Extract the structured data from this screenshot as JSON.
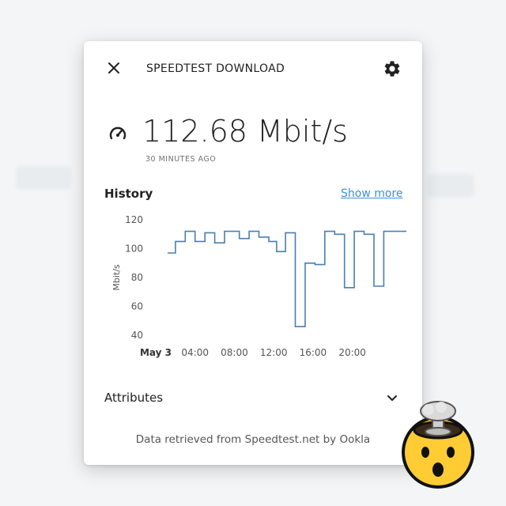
{
  "header": {
    "title": "SPEEDTEST DOWNLOAD"
  },
  "reading": {
    "value": "112.68",
    "unit": "Mbit/s",
    "time_ago": "30 MINUTES AGO"
  },
  "history": {
    "label": "History",
    "show_more": "Show more"
  },
  "chart_data": {
    "type": "line",
    "step": true,
    "ylabel": "Mbit/s",
    "ylim": [
      40,
      120
    ],
    "yticks": [
      40,
      60,
      80,
      100,
      120
    ],
    "xlim": [
      0,
      25.5
    ],
    "xticks": [
      {
        "hour": 0,
        "label": "May 3",
        "bold": true
      },
      {
        "hour": 4,
        "label": "04:00"
      },
      {
        "hour": 8,
        "label": "08:00"
      },
      {
        "hour": 12,
        "label": "12:00"
      },
      {
        "hour": 16,
        "label": "16:00"
      },
      {
        "hour": 20,
        "label": "20:00"
      }
    ],
    "color": "#4a7fb0",
    "series": [
      {
        "points": [
          [
            1.2,
            97
          ],
          [
            2.0,
            105
          ],
          [
            3.0,
            112
          ],
          [
            4.0,
            105
          ],
          [
            5.0,
            111
          ],
          [
            6.0,
            104
          ],
          [
            7.0,
            112
          ],
          [
            8.5,
            107
          ],
          [
            9.5,
            112
          ],
          [
            10.5,
            108
          ],
          [
            11.5,
            105
          ],
          [
            12.3,
            98
          ],
          [
            13.2,
            111
          ],
          [
            14.2,
            46
          ],
          [
            15.2,
            90
          ],
          [
            16.2,
            89
          ],
          [
            17.2,
            112
          ],
          [
            18.2,
            110
          ],
          [
            19.2,
            73
          ],
          [
            20.2,
            112
          ],
          [
            21.2,
            110
          ],
          [
            22.2,
            74
          ],
          [
            23.2,
            112
          ],
          [
            25.5,
            112
          ]
        ]
      }
    ]
  },
  "attributes": {
    "label": "Attributes"
  },
  "footer": {
    "text": "Data retrieved from Speedtest.net by Ookla"
  },
  "icons": {
    "close": "close-icon",
    "settings": "gear-icon",
    "gauge": "speedometer-icon",
    "expand": "chevron-down-icon",
    "emoji": "exploding-head-emoji"
  }
}
